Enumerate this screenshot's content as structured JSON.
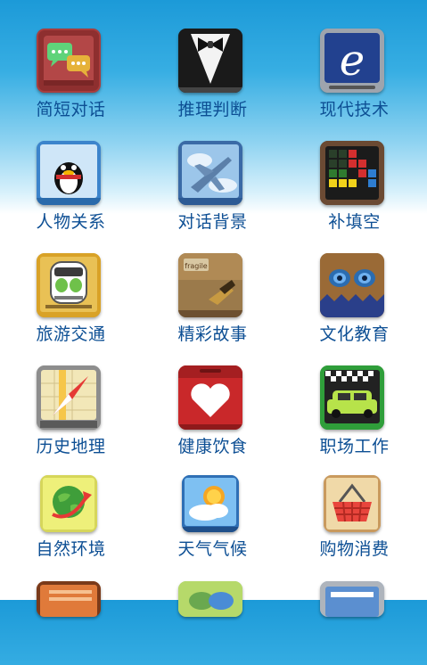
{
  "categories": [
    {
      "label": "简短对话",
      "icon": "chat-bubbles-icon",
      "color": "#a83d3d"
    },
    {
      "label": "推理判断",
      "icon": "tuxedo-icon",
      "color": "#222222"
    },
    {
      "label": "现代技术",
      "icon": "internet-explorer-icon",
      "color": "#2b4c99"
    },
    {
      "label": "人物关系",
      "icon": "penguin-icon",
      "color": "#4a90d6"
    },
    {
      "label": "对话背景",
      "icon": "airplane-icon",
      "color": "#4f7fb8"
    },
    {
      "label": "补填空",
      "icon": "tetris-blocks-icon",
      "color": "#5a4030"
    },
    {
      "label": "旅游交通",
      "icon": "train-icon",
      "color": "#d9a227"
    },
    {
      "label": "精彩故事",
      "icon": "storybox-icon",
      "color": "#8a6a3d"
    },
    {
      "label": "文化教育",
      "icon": "owl-eyes-icon",
      "color": "#8b5a2b"
    },
    {
      "label": "历史地理",
      "icon": "compass-map-icon",
      "color": "#999999"
    },
    {
      "label": "健康饮食",
      "icon": "heart-icon",
      "color": "#c9282a"
    },
    {
      "label": "职场工作",
      "icon": "taxi-icon",
      "color": "#2f9e3a"
    },
    {
      "label": "自然环境",
      "icon": "globe-arrow-icon",
      "color": "#c8c84a"
    },
    {
      "label": "天气气候",
      "icon": "sun-cloud-icon",
      "color": "#3a8ed6"
    },
    {
      "label": "购物消费",
      "icon": "shopping-basket-icon",
      "color": "#d9a76a"
    }
  ],
  "partial_row": [
    {
      "icon": "notebook-icon",
      "color": "#c85a28"
    },
    {
      "icon": "green-bubbles-icon",
      "color": "#8bc34a"
    },
    {
      "icon": "blue-window-icon",
      "color": "#7aa6d8"
    }
  ]
}
